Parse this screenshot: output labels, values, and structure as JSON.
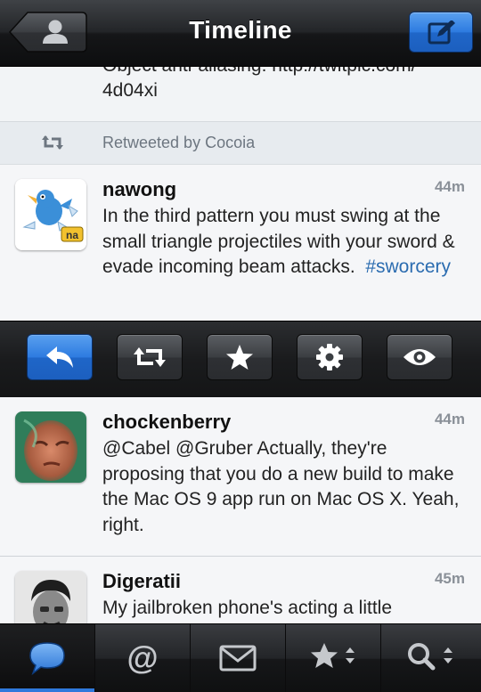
{
  "navbar": {
    "title": "Timeline"
  },
  "cut_tweet": {
    "line1": "Object anti-aliasing: http://twitpic.com/",
    "line2": "4d04xi"
  },
  "retweet": {
    "label": "Retweeted by Cocoia"
  },
  "tweets": [
    {
      "username": "nawong",
      "time": "44m",
      "text": "In the third pattern you must swing at the small triangle projectiles with your sword & evade incoming beam attacks.",
      "hashtag": "#sworcery",
      "avatar_badge": "na"
    },
    {
      "username": "chockenberry",
      "time": "44m",
      "text": "@Cabel @Gruber Actually, they're proposing that you do a new build to make the Mac OS 9 app run on Mac OS X. Yeah, right."
    },
    {
      "username": "Digeratii",
      "time": "45m",
      "text": "My jailbroken phone's acting a little"
    }
  ],
  "action_bar": {
    "buttons": [
      "reply-icon",
      "retweet-icon",
      "star-icon",
      "gear-icon",
      "eye-icon"
    ],
    "active": "reply-icon"
  },
  "tab_bar": {
    "tabs": [
      "timeline-bubble-icon",
      "mentions-at-icon",
      "messages-envelope-icon",
      "favorites-star-icon",
      "search-magnifier-icon"
    ],
    "selected": "timeline-bubble-icon"
  },
  "colors": {
    "accent": "#2d7be0",
    "hashtag": "#2b6cb0",
    "time": "#8a9098"
  }
}
